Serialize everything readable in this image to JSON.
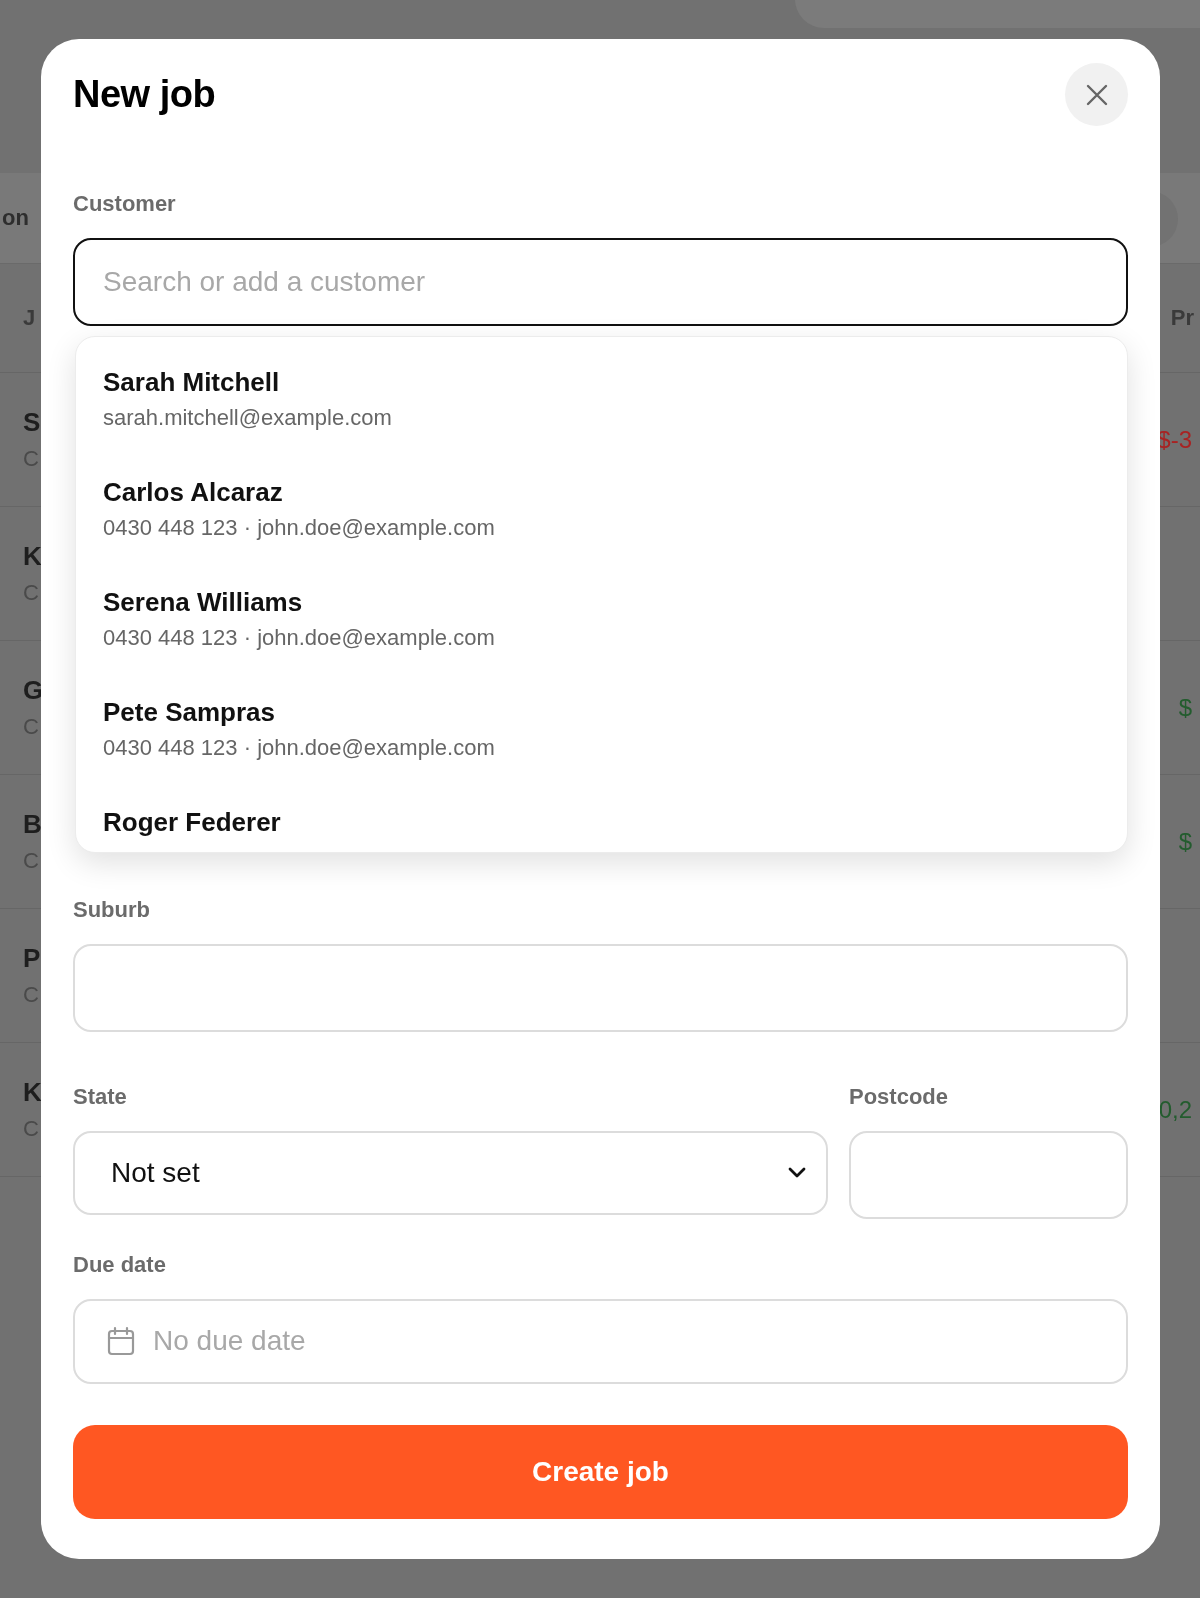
{
  "background": {
    "tab_label": "on",
    "table": {
      "columns": [
        "J",
        "Pr"
      ],
      "rows": [
        {
          "title": "S",
          "subtitle": "C",
          "profit": "$-3",
          "color": "#a82323"
        },
        {
          "title": "K",
          "subtitle": "C"
        },
        {
          "title": "G",
          "subtitle": "C",
          "profit": "$",
          "color": "#235c2e"
        },
        {
          "title": "B",
          "subtitle": "C",
          "profit": "$",
          "color": "#235c2e"
        },
        {
          "title": "P",
          "subtitle": "C"
        },
        {
          "title": "K",
          "subtitle": "C",
          "profit": "0,2",
          "color": "#235c2e"
        }
      ]
    }
  },
  "dialog": {
    "title": "New job",
    "customer": {
      "label": "Customer",
      "placeholder": "Search or add a customer",
      "suggestions": [
        {
          "name": "Sarah Mitchell",
          "detail": "sarah.mitchell@example.com"
        },
        {
          "name": "Carlos Alcaraz",
          "detail": "0430 448 123 · john.doe@example.com"
        },
        {
          "name": "Serena Williams",
          "detail": "0430 448 123 · john.doe@example.com"
        },
        {
          "name": "Pete Sampras",
          "detail": "0430 448 123 · john.doe@example.com"
        },
        {
          "name": "Roger Federer"
        }
      ]
    },
    "suburb": {
      "label": "Suburb"
    },
    "state": {
      "label": "State",
      "value": "Not set"
    },
    "postcode": {
      "label": "Postcode"
    },
    "due_date": {
      "label": "Due date",
      "placeholder": "No due date"
    },
    "submit": "Create job"
  }
}
